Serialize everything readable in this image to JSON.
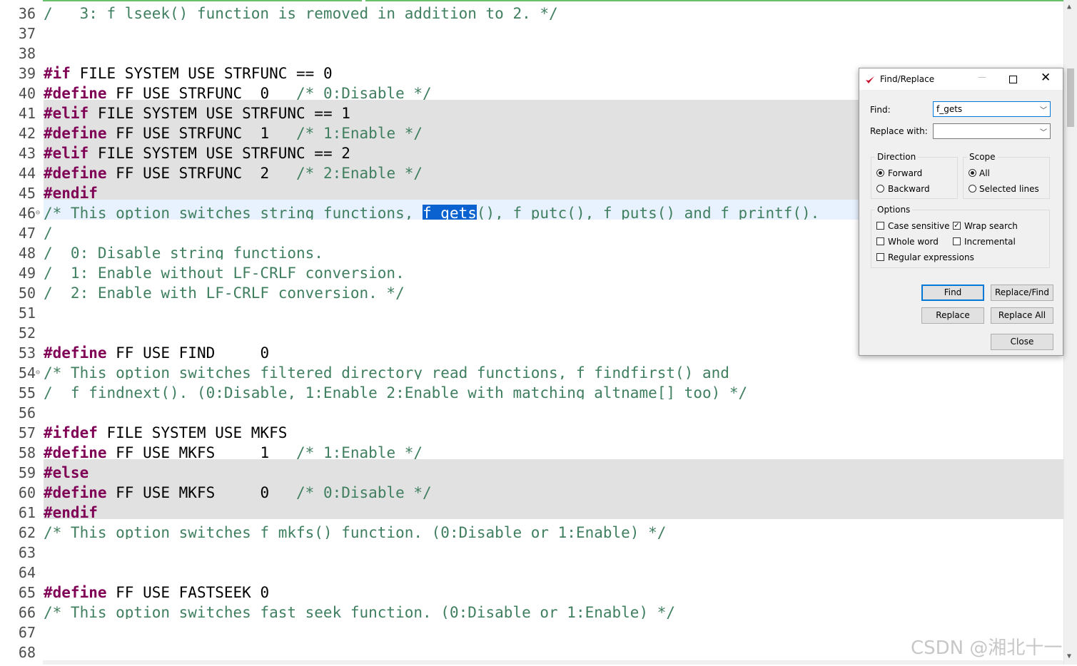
{
  "editor": {
    "lines": [
      {
        "num": "36",
        "fold": "",
        "state": "normal",
        "tokens": [
          {
            "t": "/   3: f_lseek() function is removed in addition to 2. */",
            "c": "cm"
          }
        ]
      },
      {
        "num": "37",
        "fold": "",
        "state": "normal",
        "tokens": []
      },
      {
        "num": "38",
        "fold": "",
        "state": "normal",
        "tokens": []
      },
      {
        "num": "39",
        "fold": "",
        "state": "normal",
        "tokens": [
          {
            "t": "#if",
            "c": "kw"
          },
          {
            "t": " FILE_SYSTEM_USE_STRFUNC == 0",
            "c": ""
          }
        ]
      },
      {
        "num": "40",
        "fold": "",
        "state": "normal",
        "tokens": [
          {
            "t": "#define",
            "c": "kw"
          },
          {
            "t": " FF_USE_STRFUNC  0   ",
            "c": ""
          },
          {
            "t": "/* 0:Disable */",
            "c": "cm"
          }
        ]
      },
      {
        "num": "41",
        "fold": "",
        "state": "inactive",
        "tokens": [
          {
            "t": "#elif",
            "c": "kw"
          },
          {
            "t": " FILE_SYSTEM_USE_STRFUNC == 1",
            "c": ""
          }
        ]
      },
      {
        "num": "42",
        "fold": "",
        "state": "inactive",
        "tokens": [
          {
            "t": "#define",
            "c": "kw"
          },
          {
            "t": " FF_USE_STRFUNC  1   ",
            "c": ""
          },
          {
            "t": "/* 1:Enable */",
            "c": "cm"
          }
        ]
      },
      {
        "num": "43",
        "fold": "",
        "state": "inactive",
        "tokens": [
          {
            "t": "#elif",
            "c": "kw"
          },
          {
            "t": " FILE_SYSTEM_USE_STRFUNC == 2",
            "c": ""
          }
        ]
      },
      {
        "num": "44",
        "fold": "",
        "state": "inactive",
        "tokens": [
          {
            "t": "#define",
            "c": "kw"
          },
          {
            "t": " FF_USE_STRFUNC  2   ",
            "c": ""
          },
          {
            "t": "/* 2:Enable */",
            "c": "cm"
          }
        ]
      },
      {
        "num": "45",
        "fold": "",
        "state": "inactive",
        "tokens": [
          {
            "t": "#endif",
            "c": "kw"
          }
        ]
      },
      {
        "num": "46",
        "fold": "⊖",
        "state": "current",
        "tokens": [
          {
            "t": "/* This option switches string functions, ",
            "c": "cm"
          },
          {
            "t": "f_gets",
            "c": "hl"
          },
          {
            "t": "(), f_putc(), f_puts() and f_printf().",
            "c": "cm"
          }
        ]
      },
      {
        "num": "47",
        "fold": "",
        "state": "normal",
        "tokens": [
          {
            "t": "/",
            "c": "cm"
          }
        ]
      },
      {
        "num": "48",
        "fold": "",
        "state": "normal",
        "tokens": [
          {
            "t": "/  0: Disable string functions.",
            "c": "cm"
          }
        ]
      },
      {
        "num": "49",
        "fold": "",
        "state": "normal",
        "tokens": [
          {
            "t": "/  1: Enable without LF-CRLF conversion.",
            "c": "cm"
          }
        ]
      },
      {
        "num": "50",
        "fold": "",
        "state": "normal",
        "tokens": [
          {
            "t": "/  2: Enable with LF-CRLF conversion. */",
            "c": "cm"
          }
        ]
      },
      {
        "num": "51",
        "fold": "",
        "state": "normal",
        "tokens": []
      },
      {
        "num": "52",
        "fold": "",
        "state": "normal",
        "tokens": []
      },
      {
        "num": "53",
        "fold": "",
        "state": "normal",
        "tokens": [
          {
            "t": "#define",
            "c": "kw"
          },
          {
            "t": " FF_USE_FIND     0",
            "c": ""
          }
        ]
      },
      {
        "num": "54",
        "fold": "⊖",
        "state": "normal",
        "tokens": [
          {
            "t": "/* This option switches filtered directory read functions, f_findfirst() and",
            "c": "cm"
          }
        ]
      },
      {
        "num": "55",
        "fold": "",
        "state": "normal",
        "tokens": [
          {
            "t": "/  f_findnext(). (0:Disable, 1:Enable 2:Enable with matching ",
            "c": "cm"
          },
          {
            "t": "altname",
            "c": "cm squig"
          },
          {
            "t": "[] too) */",
            "c": "cm"
          }
        ]
      },
      {
        "num": "56",
        "fold": "",
        "state": "normal",
        "tokens": []
      },
      {
        "num": "57",
        "fold": "",
        "state": "normal",
        "tokens": [
          {
            "t": "#ifdef",
            "c": "kw"
          },
          {
            "t": " FILE_SYSTEM_USE_MKFS",
            "c": ""
          }
        ]
      },
      {
        "num": "58",
        "fold": "",
        "state": "normal",
        "tokens": [
          {
            "t": "#define",
            "c": "kw"
          },
          {
            "t": " FF_USE_MKFS     1   ",
            "c": ""
          },
          {
            "t": "/* 1:Enable */",
            "c": "cm"
          }
        ]
      },
      {
        "num": "59",
        "fold": "",
        "state": "inactive",
        "tokens": [
          {
            "t": "#else",
            "c": "kw"
          }
        ]
      },
      {
        "num": "60",
        "fold": "",
        "state": "inactive",
        "tokens": [
          {
            "t": "#define",
            "c": "kw"
          },
          {
            "t": " FF_USE_MKFS     0   ",
            "c": ""
          },
          {
            "t": "/* 0:Disable */",
            "c": "cm"
          }
        ]
      },
      {
        "num": "61",
        "fold": "",
        "state": "inactive",
        "tokens": [
          {
            "t": "#endif",
            "c": "kw"
          }
        ]
      },
      {
        "num": "62",
        "fold": "",
        "state": "normal",
        "tokens": [
          {
            "t": "/* This option switches f_mkfs() function. (0:Disable or 1:Enable) */",
            "c": "cm"
          }
        ]
      },
      {
        "num": "63",
        "fold": "",
        "state": "normal",
        "tokens": []
      },
      {
        "num": "64",
        "fold": "",
        "state": "normal",
        "tokens": []
      },
      {
        "num": "65",
        "fold": "",
        "state": "normal",
        "tokens": [
          {
            "t": "#define",
            "c": "kw"
          },
          {
            "t": " FF_USE_FASTSEEK 0",
            "c": ""
          }
        ]
      },
      {
        "num": "66",
        "fold": "",
        "state": "normal",
        "tokens": [
          {
            "t": "/* This option switches fast seek function. (0:Disable or 1:Enable) */",
            "c": "cm"
          }
        ]
      },
      {
        "num": "67",
        "fold": "",
        "state": "normal",
        "tokens": []
      },
      {
        "num": "68",
        "fold": "",
        "state": "normal",
        "tokens": []
      }
    ]
  },
  "dialog": {
    "title": "Find/Replace",
    "find_label": "Find:",
    "find_value": "f_gets",
    "replace_label": "Replace with:",
    "replace_value": "",
    "direction": {
      "title": "Direction",
      "forward": "Forward",
      "backward": "Backward",
      "selected": "forward"
    },
    "scope": {
      "title": "Scope",
      "all": "All",
      "selected_lines": "Selected lines",
      "selected": "all"
    },
    "options": {
      "title": "Options",
      "case_sensitive": {
        "label": "Case sensitive",
        "checked": false
      },
      "wrap_search": {
        "label": "Wrap search",
        "checked": true
      },
      "whole_word": {
        "label": "Whole word",
        "checked": false
      },
      "incremental": {
        "label": "Incremental",
        "checked": false
      },
      "regular_expressions": {
        "label": "Regular expressions",
        "checked": false
      }
    },
    "buttons": {
      "find": "Find",
      "replace_find": "Replace/Find",
      "replace": "Replace",
      "replace_all": "Replace All",
      "close": "Close"
    }
  },
  "watermark": "CSDN @湘北十一",
  "colors": {
    "keyword": "#7f0055",
    "comment": "#3f7f5f",
    "selection": "#0a62d0",
    "inactive_block": "#e1e1e1",
    "current_line": "#e8f2fe"
  }
}
